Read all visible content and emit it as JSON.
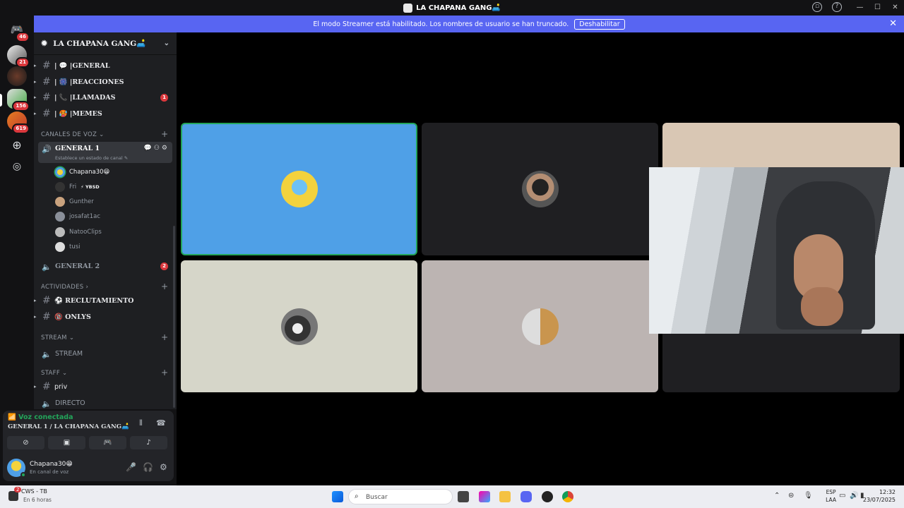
{
  "window": {
    "title": "LA CHAPANA GANG🛋️"
  },
  "serverbar": {
    "badges": [
      "46",
      "21",
      "156",
      "619"
    ]
  },
  "streamer": {
    "message": "El modo Streamer está habilitado. Los nombres de usuario se han truncado.",
    "button": "Deshabilitar"
  },
  "server": {
    "name": "LA CHAPANA GANG🛋️"
  },
  "text_channels": [
    {
      "name": "| 💬 |GENERAL"
    },
    {
      "name": "| 🎆 |REACCIONES"
    },
    {
      "name": "| 📞 |LLAMADAS",
      "badge": "1"
    },
    {
      "name": "| 🥵 |MEMES"
    }
  ],
  "categories": {
    "voice": "CANALES DE VOZ ⌄",
    "activities": "ACTIVIDADES ›",
    "stream": "STREAM ⌄",
    "staff": "STAFF ⌄"
  },
  "voice_channel": {
    "name": "GENERAL 1",
    "status": "Establece un estado de canal ✎"
  },
  "voice_users": [
    {
      "name": "Chapana30😁"
    },
    {
      "name": "Fri",
      "tag": "⚡ YBSD"
    },
    {
      "name": "Gunther"
    },
    {
      "name": "josafat1ac"
    },
    {
      "name": "NatooClips"
    },
    {
      "name": "tusi"
    }
  ],
  "voice_channel_2": {
    "name": "GENERAL 2",
    "badge": "2"
  },
  "activity_channels": [
    {
      "name": "⚽ RECLUTAMIENTO"
    },
    {
      "name": "🔞 ONLYS"
    }
  ],
  "stream_channel": {
    "name": "STREAM"
  },
  "staff_channels": {
    "priv": "priv",
    "directo": "DIRECTO"
  },
  "voice_panel": {
    "title": "Voz conectada",
    "subtitle": "GENERAL 1 / LA CHAPANA GANG🛋️"
  },
  "user": {
    "name": "Chapana30😁",
    "status": "En canal de voz"
  },
  "taskbar": {
    "app": "CWS - TB",
    "app_sub": "En 6 horas",
    "search_placeholder": "Buscar",
    "lang1": "ESP",
    "lang2": "LAA",
    "time": "12:32",
    "date": "23/07/2025",
    "notif_count": "2"
  },
  "colors": {
    "accent": "#5865f2",
    "online": "#23a55a",
    "badge": "#da373c",
    "speaking_tile": "#4fa0e7"
  }
}
